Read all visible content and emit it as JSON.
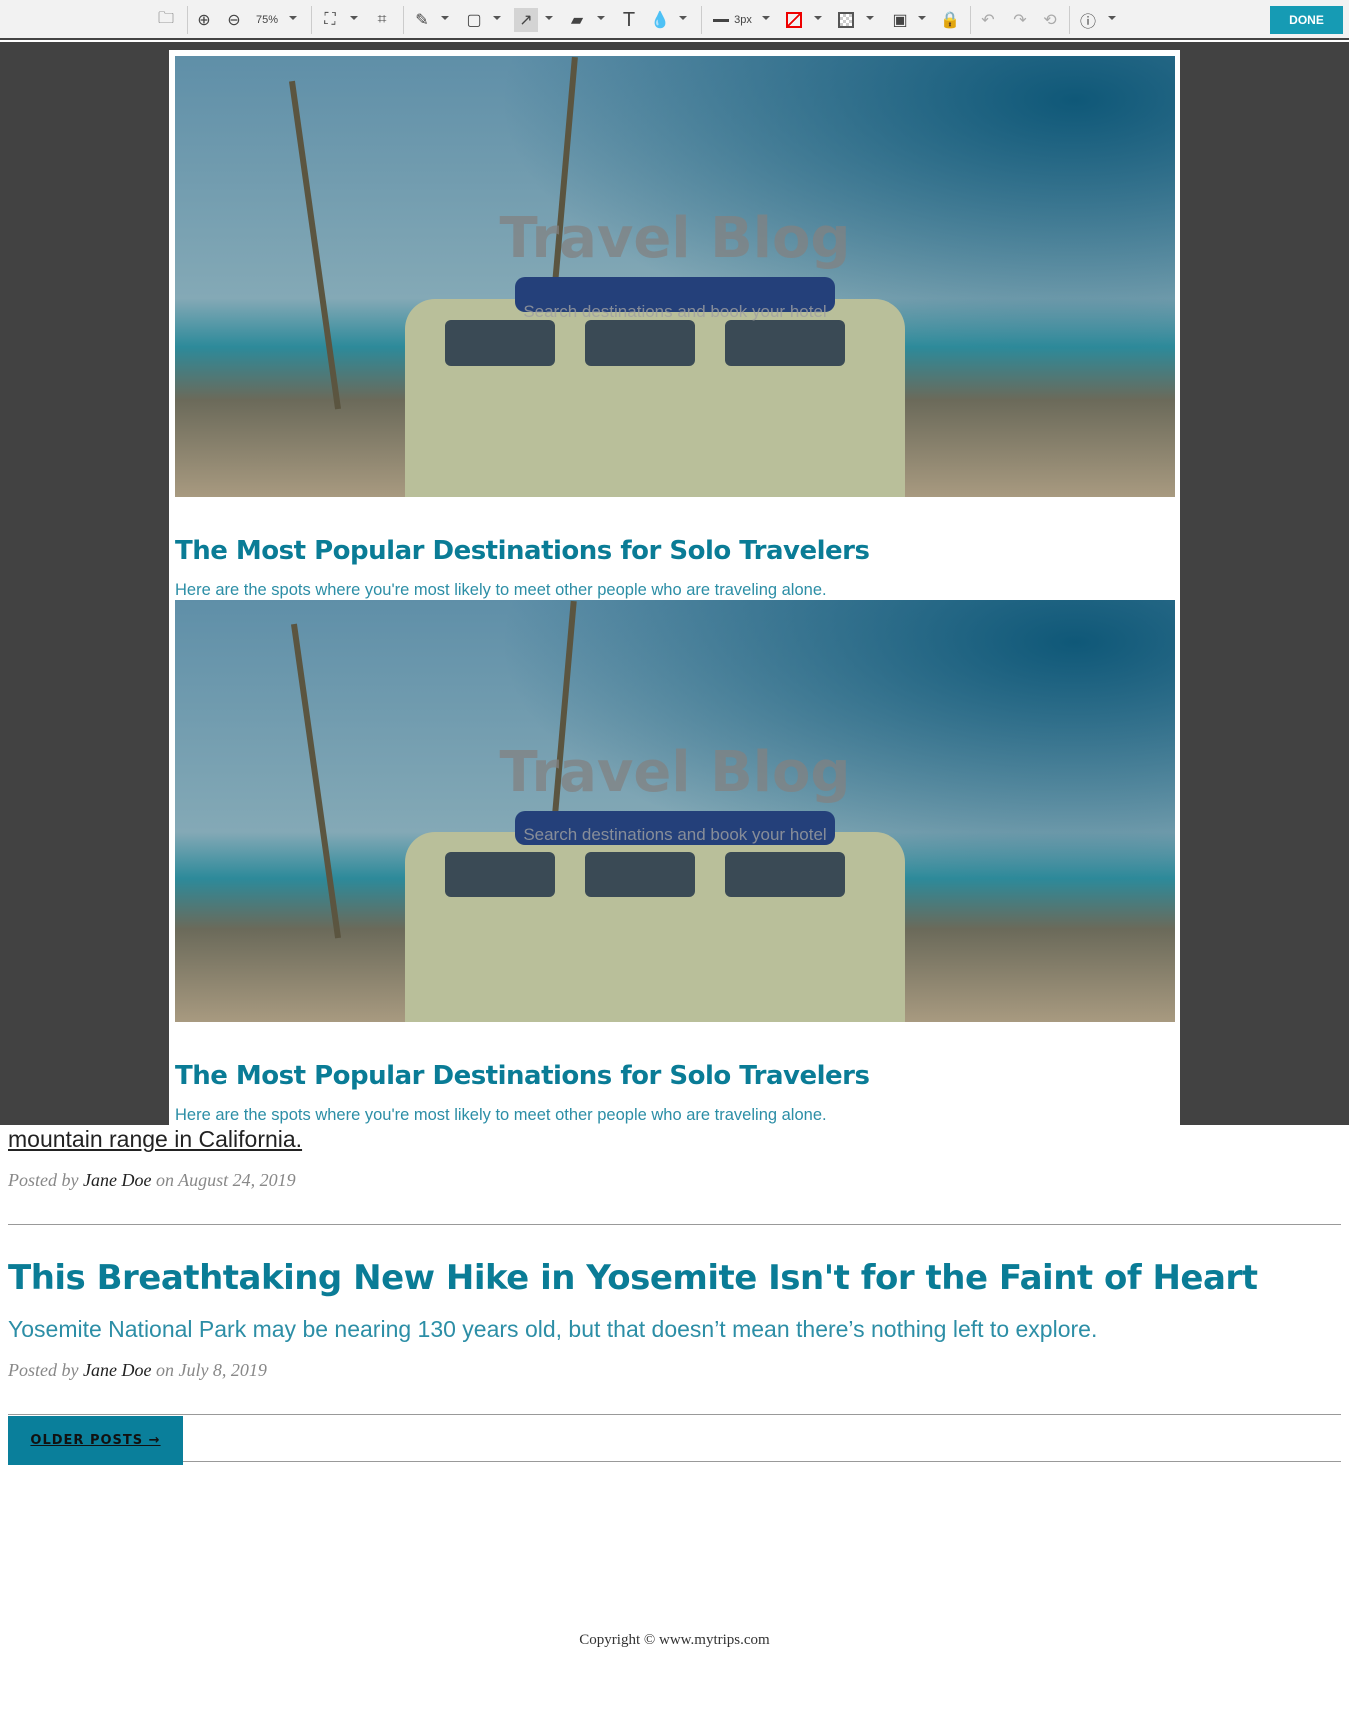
{
  "toolbar": {
    "zoom": "75%",
    "stroke": "3px",
    "done": "DONE"
  },
  "hero": {
    "title": "Travel Blog",
    "subtitle": "Search destinations and book your hotel"
  },
  "posts_preview": [
    {
      "title": "The Most Popular Destinations for Solo Travelers",
      "subtitle": "Here are the spots where you're most likely to meet other people who are traveling alone."
    },
    {
      "title": "The Most Popular Destinations for Solo Travelers",
      "subtitle": "Here are the spots where you're most likely to meet other people who are traveling alone."
    }
  ],
  "post1": {
    "link_tail": "mountain range in California.",
    "posted_by": "Posted by",
    "author": "Jane Doe",
    "on": "on",
    "date": "August 24, 2019"
  },
  "post2": {
    "title": "This Breathtaking New Hike in Yosemite Isn't for the Faint of Heart",
    "subtitle": "Yosemite National Park may be nearing 130 years old, but that doesn’t mean there’s nothing left to explore.",
    "posted_by": "Posted by",
    "author": "Jane Doe",
    "on": "on",
    "date": "July 8, 2019"
  },
  "older_posts": "OLDER POSTS →",
  "footer": {
    "copyright": "Copyright © www.mytrips.com"
  }
}
